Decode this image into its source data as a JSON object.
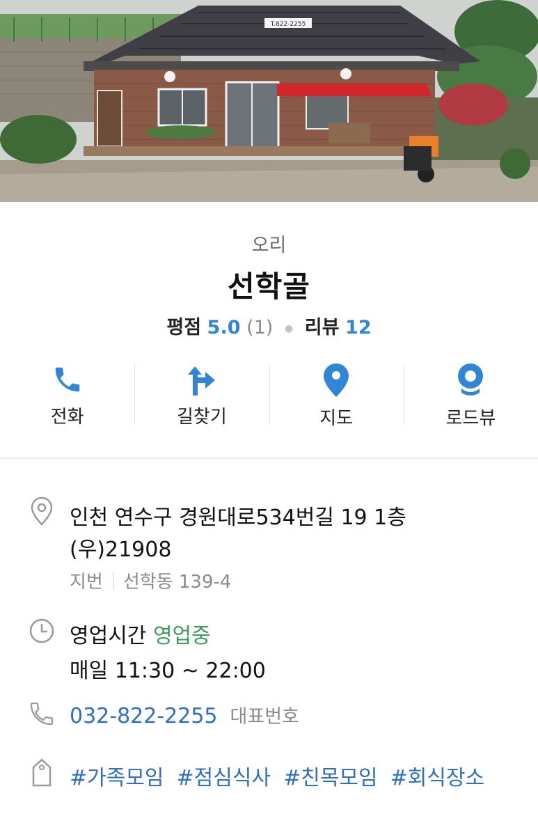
{
  "hero": {
    "sign_phone": "T.822-2255"
  },
  "place": {
    "category": "오리",
    "name": "선학골",
    "rating_label": "평점",
    "rating_value": "5.0",
    "rating_count": "(1)",
    "review_label": "리뷰",
    "review_count": "12"
  },
  "actions": [
    {
      "label": "전화",
      "icon": "phone-icon"
    },
    {
      "label": "길찾기",
      "icon": "directions-icon"
    },
    {
      "label": "지도",
      "icon": "map-pin-icon"
    },
    {
      "label": "로드뷰",
      "icon": "roadview-icon"
    }
  ],
  "address": {
    "road": "인천 연수구 경원대로534번길 19 1층",
    "postal": "(우)21908",
    "jibun_label": "지번",
    "jibun": "선학동 139-4"
  },
  "hours": {
    "label": "영업시간",
    "status": "영업중",
    "detail": "매일 11:30 ~ 22:00"
  },
  "phone": {
    "number": "032-822-2255",
    "note": "대표번호"
  },
  "tags": [
    "#가족모임",
    "#점심식사",
    "#친목모임",
    "#회식장소"
  ],
  "colors": {
    "accent_blue": "#2f86d6",
    "link_blue": "#2f6fc1",
    "open_green": "#3c9a5f",
    "muted_gray": "#8a8a8a"
  }
}
